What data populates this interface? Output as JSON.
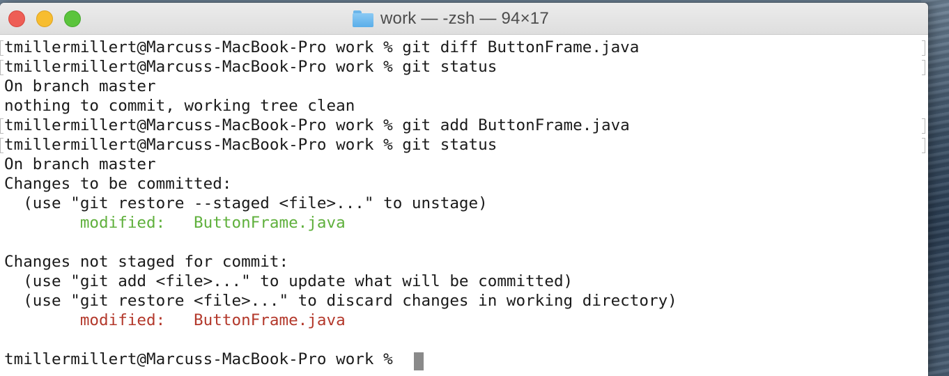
{
  "window": {
    "title": "work — -zsh — 94×17"
  },
  "terminal": {
    "lines": [
      "tmillermillert@Marcuss-MacBook-Pro work % git diff ButtonFrame.java",
      "tmillermillert@Marcuss-MacBook-Pro work % git status",
      "On branch master",
      "nothing to commit, working tree clean",
      "tmillermillert@Marcuss-MacBook-Pro work % git add ButtonFrame.java",
      "tmillermillert@Marcuss-MacBook-Pro work % git status",
      "On branch master",
      "Changes to be committed:",
      "  (use \"git restore --staged <file>...\" to unstage)",
      "        modified:   ButtonFrame.java",
      "",
      "Changes not staged for commit:",
      "  (use \"git add <file>...\" to update what will be committed)",
      "  (use \"git restore <file>...\" to discard changes in working directory)",
      "        modified:   ButtonFrame.java",
      "",
      "tmillermillert@Marcuss-MacBook-Pro work % "
    ],
    "colors": {
      "staged": "#5fb03c",
      "unstaged": "#b3382b",
      "text": "#1a1a1a"
    }
  }
}
